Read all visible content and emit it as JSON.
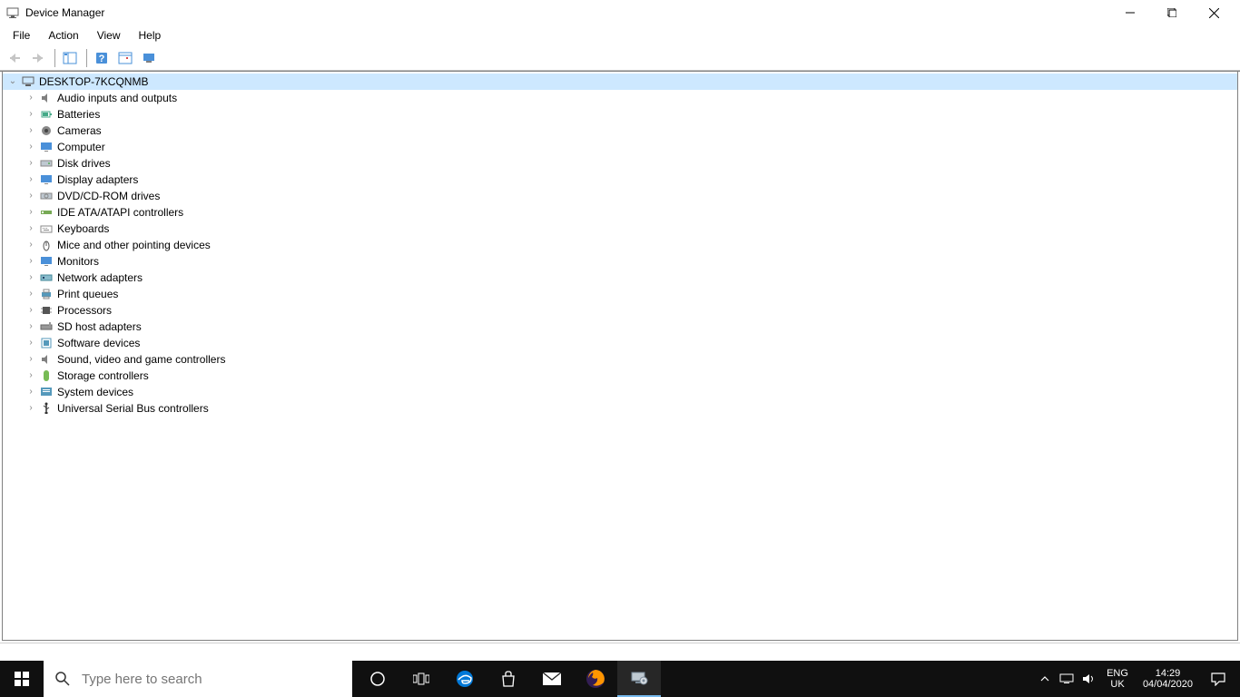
{
  "window": {
    "title": "Device Manager"
  },
  "menubar": {
    "file": "File",
    "action": "Action",
    "view": "View",
    "help": "Help"
  },
  "tree": {
    "root": "DESKTOP-7KCQNMB",
    "categories": [
      "Audio inputs and outputs",
      "Batteries",
      "Cameras",
      "Computer",
      "Disk drives",
      "Display adapters",
      "DVD/CD-ROM drives",
      "IDE ATA/ATAPI controllers",
      "Keyboards",
      "Mice and other pointing devices",
      "Monitors",
      "Network adapters",
      "Print queues",
      "Processors",
      "SD host adapters",
      "Software devices",
      "Sound, video and game controllers",
      "Storage controllers",
      "System devices",
      "Universal Serial Bus controllers"
    ]
  },
  "taskbar": {
    "search_placeholder": "Type here to search",
    "lang_top": "ENG",
    "lang_bottom": "UK",
    "time": "14:29",
    "date": "04/04/2020"
  }
}
